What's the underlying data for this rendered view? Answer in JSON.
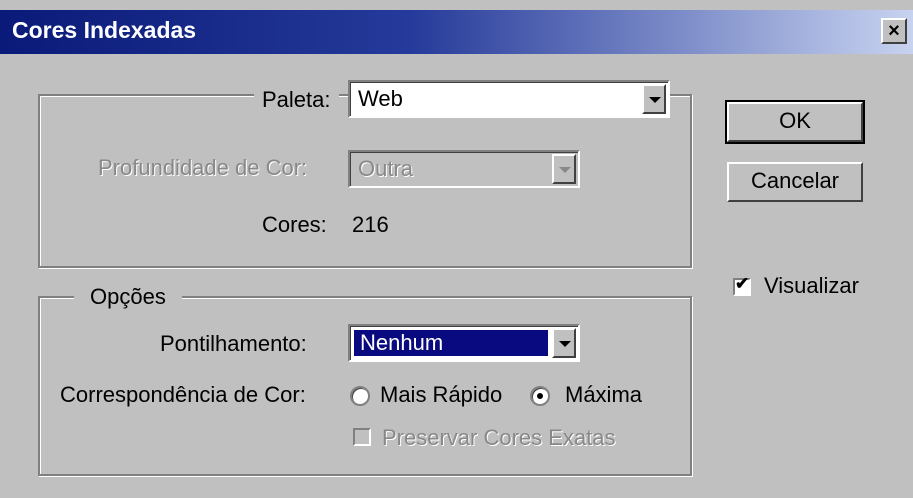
{
  "window": {
    "title": "Cores Indexadas",
    "close_glyph": "×"
  },
  "palette_group": {
    "palette_label": "Paleta:",
    "palette_value": "Web",
    "depth_label": "Profundidade de Cor:",
    "depth_value": "Outra",
    "colors_label": "Cores:",
    "colors_value": "216"
  },
  "options_group": {
    "title": "Opções",
    "dither_label": "Pontilhamento:",
    "dither_value": "Nenhum",
    "match_label": "Correspondência de Cor:",
    "radio_faster": "Mais Rápido",
    "radio_maximum": "Máxima",
    "preserve_label": "Preservar Cores Exatas"
  },
  "buttons": {
    "ok": "OK",
    "cancel": "Cancelar"
  },
  "preview": {
    "label": "Visualizar",
    "checked": true
  }
}
